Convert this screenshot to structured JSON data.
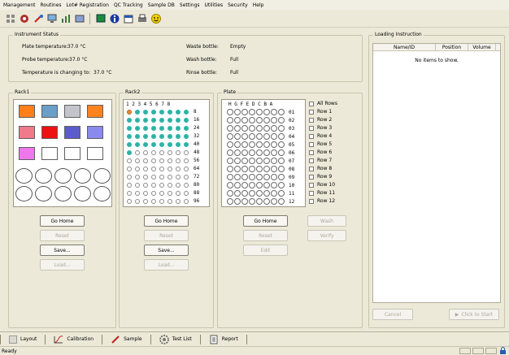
{
  "menu": [
    "Management",
    "Routines",
    "Lot# Registration",
    "QC Tracking",
    "Sample DB",
    "Settings",
    "Utilities",
    "Security",
    "Help"
  ],
  "toolbar_icons": [
    "grid-icon",
    "settings-wheel-icon",
    "wrench-icon",
    "monitor-icon",
    "chart-icon",
    "rack-icon",
    "screen-icon",
    "info-icon",
    "calendar-icon",
    "print-icon",
    "smiley-icon"
  ],
  "instrument_status": {
    "title": "Instrument Status",
    "plate_temp_label": "Plate temperature:",
    "plate_temp_value": "37.0 °C",
    "probe_temp_label": "Probe temperature:",
    "probe_temp_value": "37.0 °C",
    "temp_changing_label": "Temperature is changing to:",
    "temp_changing_value": "37.0 °C",
    "waste_label": "Waste bottle:",
    "waste_value": "Empty",
    "wash_label": "Wash bottle:",
    "wash_value": "Full",
    "rinse_label": "Rinse bottle:",
    "rinse_value": "Full"
  },
  "rack1": {
    "title": "Rack1",
    "colors": [
      "#ff7f1a",
      "#6a9fc8",
      "#c4c4cc",
      "#ff8420",
      "#f07a8a",
      "#ee1111",
      "#5c5ccc",
      "#8a8aee",
      "#ee77ee",
      "#ffffff",
      "#ffffff",
      "#ffffff"
    ],
    "buttons": {
      "home": "Go Home",
      "reset": "Reset",
      "save": "Save...",
      "load": "Load..."
    }
  },
  "rack2": {
    "title": "Rack2",
    "col_header": "1 2 3 4 5 6 7 8",
    "row_numbers": [
      "8",
      "16",
      "24",
      "32",
      "40",
      "48",
      "56",
      "64",
      "72",
      "80",
      "88",
      "96"
    ],
    "filled_counts": [
      8,
      8,
      8,
      8,
      8,
      1,
      0,
      0,
      0,
      0,
      0,
      0
    ],
    "buttons": {
      "home": "Go Home",
      "reset": "Reset",
      "save": "Save...",
      "load": "Load..."
    }
  },
  "plate": {
    "title": "Plate",
    "col_header": "H G F E D C B A",
    "row_numbers": [
      "01",
      "02",
      "03",
      "04",
      "05",
      "06",
      "07",
      "08",
      "09",
      "10",
      "11",
      "12"
    ],
    "all_rows_label": "All Rows",
    "row_checks": [
      "Row 1",
      "Row 2",
      "Row 3",
      "Row 4",
      "Row 5",
      "Row 6",
      "Row 7",
      "Row 8",
      "Row 9",
      "Row 10",
      "Row 11",
      "Row 12"
    ],
    "buttons": {
      "home": "Go Home",
      "reset": "Reset",
      "edit": "Edit",
      "wash": "Wash",
      "verify": "Verify"
    }
  },
  "loading": {
    "title": "Loading Instruction",
    "columns": [
      "Name/ID",
      "Position",
      "Volume"
    ],
    "empty_text": "No items to show.",
    "cancel": "Cancel",
    "click_to_start": "Click to Start"
  },
  "tabs": [
    "Layout",
    "Calibration",
    "Sample",
    "Test List",
    "Report"
  ],
  "status": "Ready"
}
